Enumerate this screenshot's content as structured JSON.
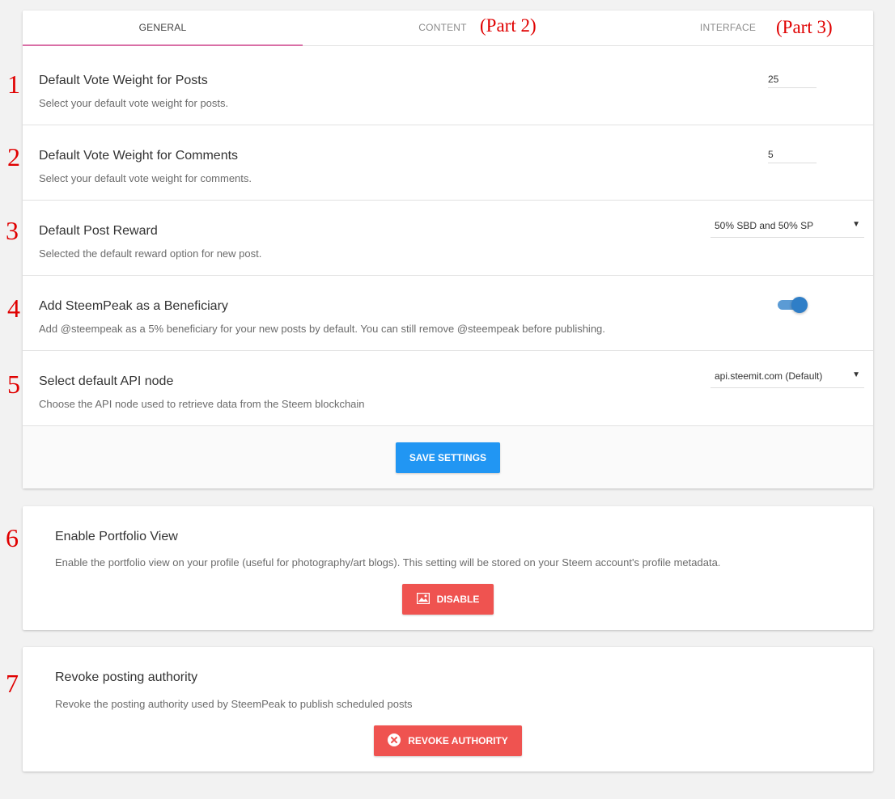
{
  "tabs": [
    {
      "label": "GENERAL",
      "active": true
    },
    {
      "label": "CONTENT",
      "active": false
    },
    {
      "label": "INTERFACE",
      "active": false
    }
  ],
  "settings": {
    "vote_posts": {
      "title": "Default Vote Weight for Posts",
      "desc": "Select your default vote weight for posts.",
      "value": "25"
    },
    "vote_comments": {
      "title": "Default Vote Weight for Comments",
      "desc": "Select your default vote weight for comments.",
      "value": "5"
    },
    "post_reward": {
      "title": "Default Post Reward",
      "desc": "Selected the default reward option for new post.",
      "selected": "50% SBD and 50% SP"
    },
    "beneficiary": {
      "title": "Add SteemPeak as a Beneficiary",
      "desc": "Add @steempeak as a 5% beneficiary for your new posts by default. You can still remove @steempeak before publishing.",
      "enabled": true
    },
    "api_node": {
      "title": "Select default API node",
      "desc": "Choose the API node used to retrieve data from the Steem blockchain",
      "selected": "api.steemit.com (Default)"
    }
  },
  "save_label": "SAVE SETTINGS",
  "portfolio": {
    "title": "Enable Portfolio View",
    "desc": "Enable the portfolio view on your profile (useful for photography/art blogs). This setting will be stored on your Steem account's profile metadata.",
    "button_label": "DISABLE",
    "button_icon": "image-icon"
  },
  "revoke": {
    "title": "Revoke posting authority",
    "desc": "Revoke the posting authority used by SteemPeak to publish scheduled posts",
    "button_label": "REVOKE AUTHORITY",
    "button_icon": "close-circle-icon"
  },
  "annotations": {
    "part2": "(Part 2)",
    "part3": "(Part 3)",
    "numbers": [
      "1",
      "2",
      "3",
      "4",
      "5",
      "6",
      "7"
    ]
  },
  "colors": {
    "tab_indicator": "#d96fa6",
    "primary_button": "#2196f3",
    "danger_button": "#ef5350",
    "toggle_on": "#2f7ec7",
    "annotation": "#e00000"
  }
}
